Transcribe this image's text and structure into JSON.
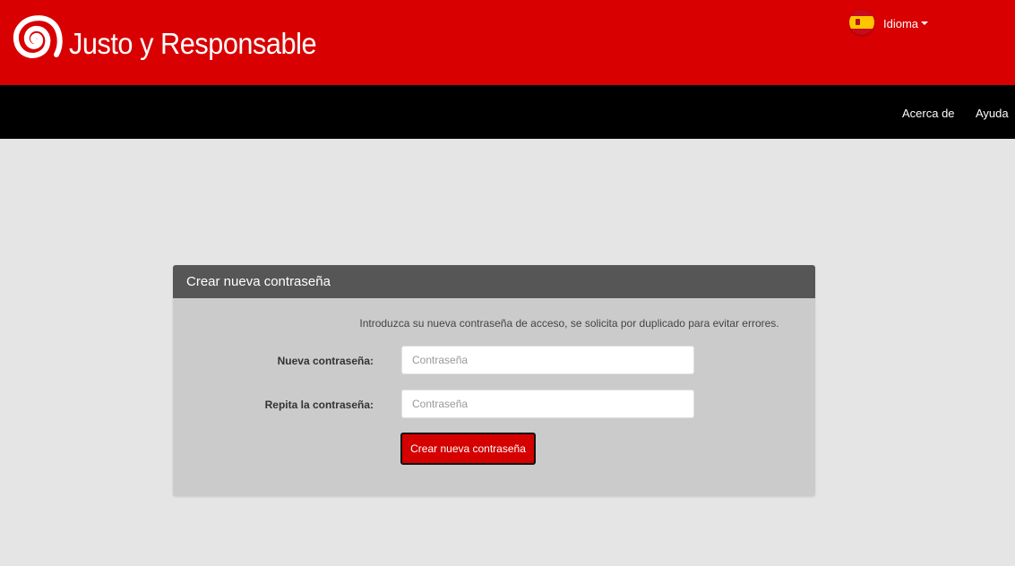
{
  "header": {
    "brand_title": "Justo y Responsable",
    "logo_icon": "spiral-logo-icon",
    "language_label": "Idioma",
    "language_flag_icon": "spain-flag-icon",
    "brand_color": "#d80000"
  },
  "nav": {
    "items": [
      {
        "label": "Acerca de"
      },
      {
        "label": "Ayuda"
      }
    ]
  },
  "panel": {
    "title": "Crear nueva contraseña",
    "intro_text": "Introduzca su nueva contraseña de acceso, se solicita por duplicado para evitar errores.",
    "fields": [
      {
        "label": "Nueva contraseña:",
        "value": "",
        "placeholder": "Contraseña"
      },
      {
        "label": "Repita la contraseña:",
        "value": "",
        "placeholder": "Contraseña"
      }
    ],
    "submit_label": "Crear nueva contraseña"
  }
}
